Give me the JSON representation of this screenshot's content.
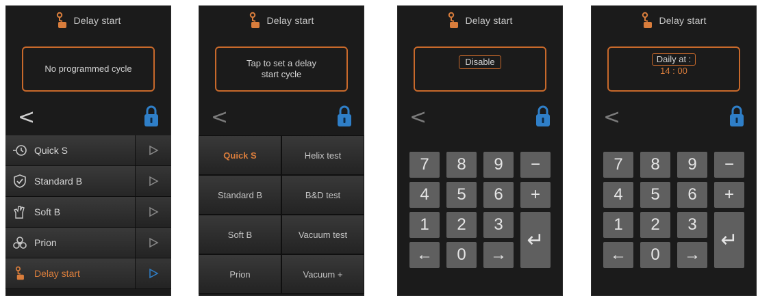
{
  "screens": [
    {
      "title": "Delay start",
      "message": "No programmed cycle",
      "back_glyph": "<",
      "items": [
        {
          "label": "Quick S",
          "icon": "quick-cycle-icon"
        },
        {
          "label": "Standard B",
          "icon": "shield-check-icon"
        },
        {
          "label": "Soft B",
          "icon": "glove-icon"
        },
        {
          "label": "Prion",
          "icon": "biohazard-icon"
        },
        {
          "label": "Delay start",
          "icon": "delay-start-icon",
          "active": true
        }
      ],
      "play_glyph": "▷"
    },
    {
      "title": "Delay start",
      "message_line1": "Tap to set a delay",
      "message_line2": "start cycle",
      "back_glyph": "<",
      "cycles": [
        {
          "label": "Quick S",
          "selected": true
        },
        {
          "label": "Helix test"
        },
        {
          "label": "Standard B"
        },
        {
          "label": "B&D test"
        },
        {
          "label": "Soft B"
        },
        {
          "label": "Vacuum test"
        },
        {
          "label": "Prion"
        },
        {
          "label": "Vacuum +"
        }
      ]
    },
    {
      "title": "Delay start",
      "message": "Disable",
      "back_glyph": "<",
      "keys": [
        "7",
        "8",
        "9",
        "−",
        "4",
        "5",
        "6",
        "+",
        "1",
        "2",
        "3",
        "↵",
        "←",
        "0",
        "→"
      ]
    },
    {
      "title": "Delay start",
      "daily_label": "Daily at :",
      "daily_time": "14 : 00",
      "back_glyph": "<",
      "keys": [
        "7",
        "8",
        "9",
        "−",
        "4",
        "5",
        "6",
        "+",
        "1",
        "2",
        "3",
        "↵",
        "←",
        "0",
        "→"
      ]
    }
  ],
  "colors": {
    "accent": "#c8692b",
    "lock": "#2f7fc8",
    "panel": "#1b1b1b",
    "key": "#5f5f5f"
  }
}
